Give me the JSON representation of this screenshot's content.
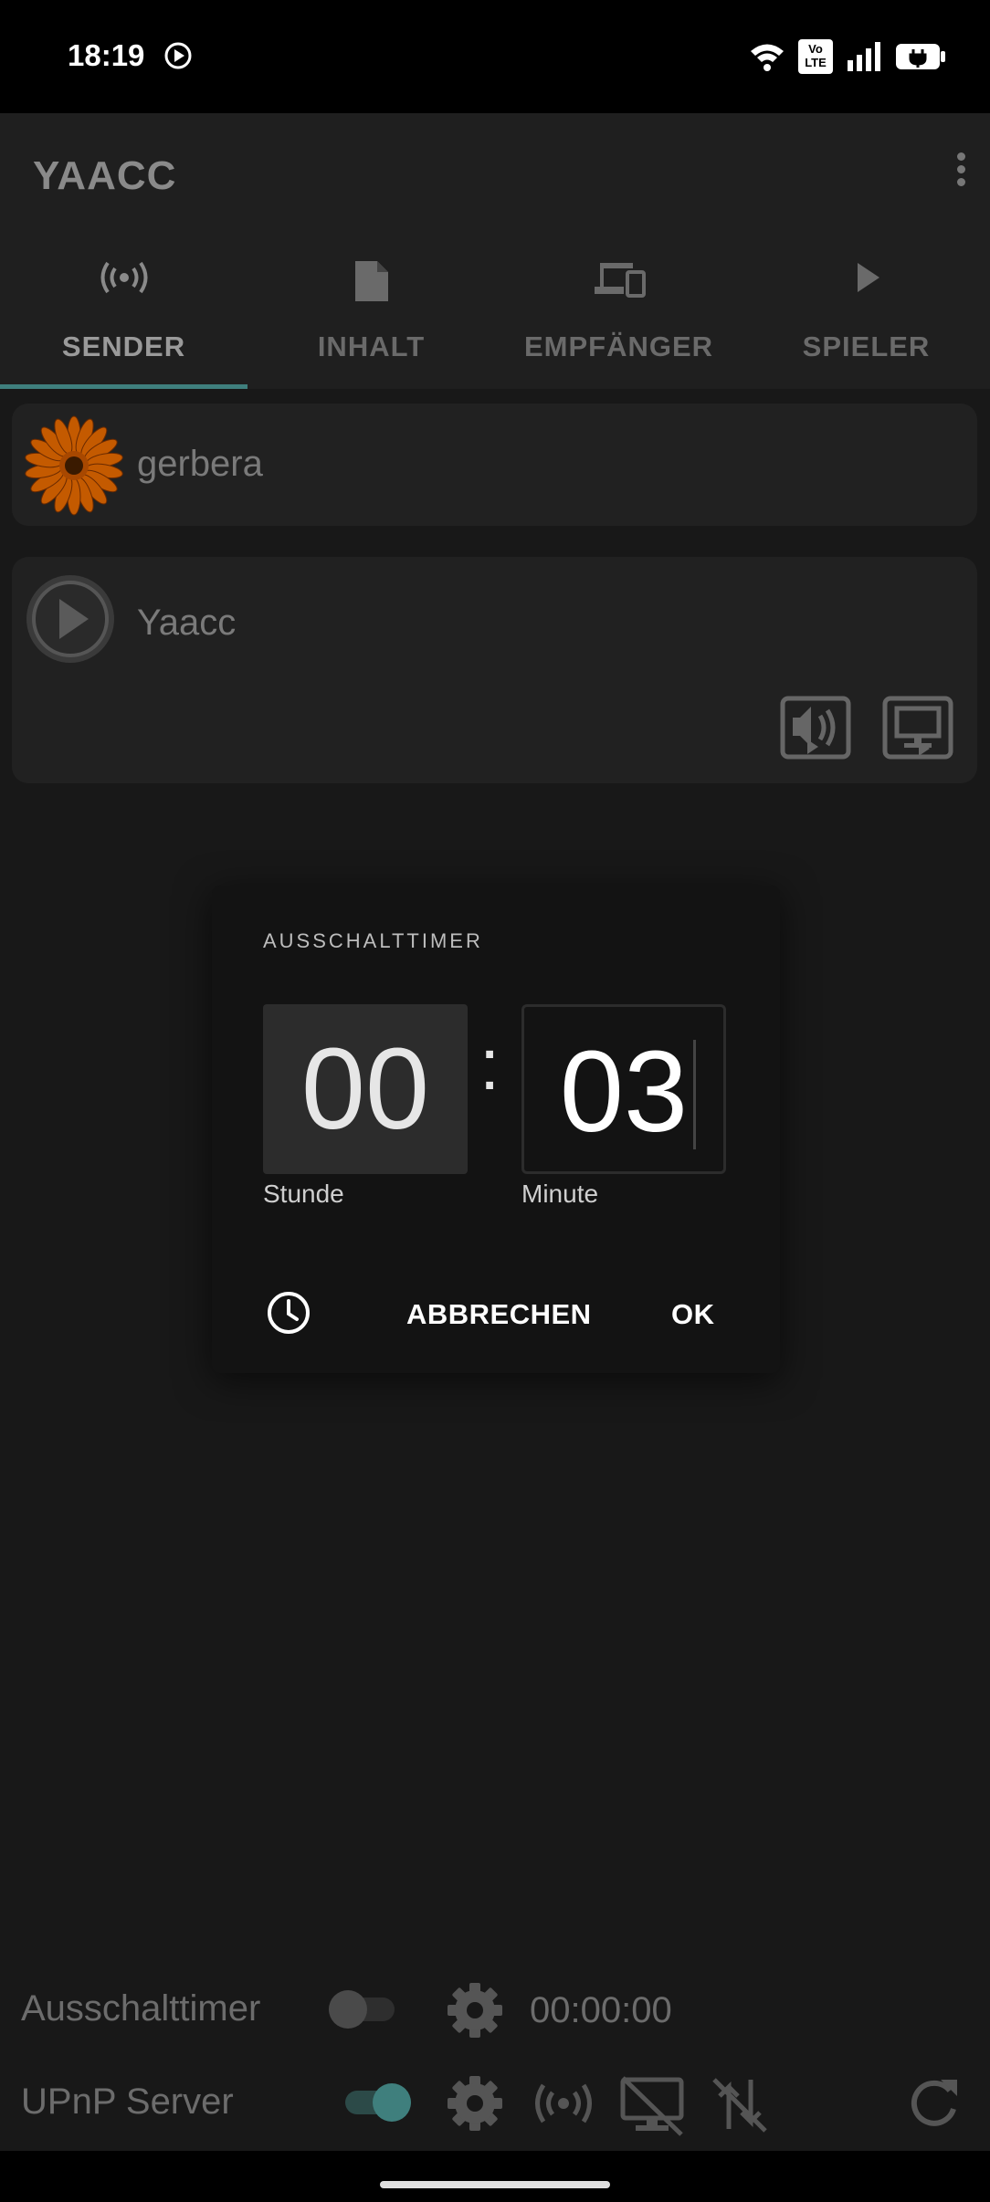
{
  "status_bar": {
    "time": "18:19",
    "lte_line1": "Vo",
    "lte_line2": "LTE"
  },
  "app": {
    "title": "YAACC"
  },
  "tabs": [
    {
      "label": "SENDER",
      "icon": "broadcast-icon",
      "active": true
    },
    {
      "label": "INHALT",
      "icon": "file-icon",
      "active": false
    },
    {
      "label": "EMPFÄNGER",
      "icon": "devices-icon",
      "active": false
    },
    {
      "label": "SPIELER",
      "icon": "play-icon",
      "active": false
    }
  ],
  "devices": [
    {
      "name": "gerbera",
      "icon": "gerbera-flower-icon"
    },
    {
      "name": "Yaacc",
      "icon": "play-circle-icon"
    }
  ],
  "dialog": {
    "title": "AUSSCHALTTIMER",
    "hours": "00",
    "minutes": "03",
    "separator": ":",
    "hours_caption": "Stunde",
    "minutes_caption": "Minute",
    "cancel_label": "ABBRECHEN",
    "ok_label": "OK"
  },
  "bottom": {
    "timer_label": "Ausschalttimer",
    "timer_enabled": false,
    "timer_value": "00:00:00",
    "upnp_label": "UPnP Server",
    "upnp_enabled": true
  },
  "colors": {
    "accent": "#3f7f7d",
    "gerbera": "#c45a00"
  }
}
